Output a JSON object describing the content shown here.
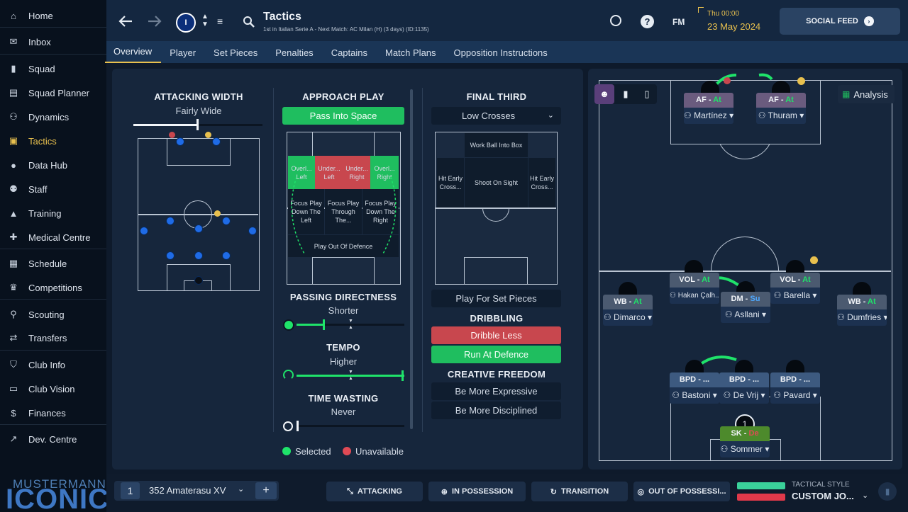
{
  "sidebar": {
    "items": [
      {
        "label": "Home",
        "icon": "home-icon",
        "glyph": "⌂"
      },
      {
        "label": "Inbox",
        "icon": "inbox-icon",
        "glyph": "✉"
      },
      {
        "label": "Squad",
        "icon": "shirt-icon",
        "glyph": "▮"
      },
      {
        "label": "Squad Planner",
        "icon": "clipboard-icon",
        "glyph": "▤"
      },
      {
        "label": "Dynamics",
        "icon": "people-icon",
        "glyph": "⚇"
      },
      {
        "label": "Tactics",
        "icon": "tactics-board-icon",
        "glyph": "▣"
      },
      {
        "label": "Data Hub",
        "icon": "globe-icon",
        "glyph": "●"
      },
      {
        "label": "Staff",
        "icon": "staff-icon",
        "glyph": "⚉"
      },
      {
        "label": "Training",
        "icon": "cone-icon",
        "glyph": "▲"
      },
      {
        "label": "Medical Centre",
        "icon": "medical-icon",
        "glyph": "✚"
      },
      {
        "label": "Schedule",
        "icon": "calendar-icon",
        "glyph": "▦"
      },
      {
        "label": "Competitions",
        "icon": "trophy-icon",
        "glyph": "♛"
      },
      {
        "label": "Scouting",
        "icon": "magnifier-icon",
        "glyph": "⚲"
      },
      {
        "label": "Transfers",
        "icon": "transfer-icon",
        "glyph": "⇄"
      },
      {
        "label": "Club Info",
        "icon": "shield-icon",
        "glyph": "⛉"
      },
      {
        "label": "Club Vision",
        "icon": "briefcase-icon",
        "glyph": "▭"
      },
      {
        "label": "Finances",
        "icon": "money-icon",
        "glyph": "$"
      },
      {
        "label": "Dev. Centre",
        "icon": "trend-icon",
        "glyph": "↗"
      }
    ],
    "brand_top": "MUSTERMANN",
    "brand_bottom": "ICONIC"
  },
  "header": {
    "title": "Tactics",
    "subtitle": "1st in Italian Serie A - Next Match: AC Milan (H) (3 days) (ID:1135)",
    "fm": "FM",
    "day": "Thu 00:00",
    "date": "23 May 2024",
    "social": "SOCIAL FEED"
  },
  "tabs": [
    "Overview",
    "Player",
    "Set Pieces",
    "Penalties",
    "Captains",
    "Match Plans",
    "Opposition Instructions"
  ],
  "attacking_width": {
    "title": "ATTACKING WIDTH",
    "value": "Fairly Wide",
    "level": 0.5
  },
  "approach": {
    "title": "APPROACH PLAY",
    "selected": "Pass Into Space",
    "zones": {
      "ol": "Overl... Left",
      "ul": "Under... Left",
      "ur": "Under... Right",
      "or": "Overl... Right",
      "fl": "Focus Play Down The Left",
      "fc": "Focus Play Through The...",
      "fr": "Focus Play Down The Right",
      "out": "Play Out Of Defence"
    }
  },
  "passing": {
    "title": "PASSING DIRECTNESS",
    "value": "Shorter",
    "level": 0.25
  },
  "tempo": {
    "title": "TEMPO",
    "value": "Higher",
    "level": 1.0
  },
  "timewasting": {
    "title": "TIME WASTING",
    "value": "Never",
    "level": 0.0
  },
  "final_third": {
    "title": "FINAL THIRD",
    "dropdown": "Low Crosses",
    "zones": {
      "work": "Work Ball Into Box",
      "hl": "Hit Early Cross...",
      "shoot": "Shoot On Sight",
      "hr": "Hit Early Cross..."
    },
    "setpieces": "Play For Set Pieces"
  },
  "dribbling": {
    "title": "DRIBBLING",
    "less": "Dribble Less",
    "run": "Run At Defence"
  },
  "creative": {
    "title": "CREATIVE FREEDOM",
    "expr": "Be More Expressive",
    "disc": "Be More Disciplined"
  },
  "legend": {
    "selected": "Selected",
    "unavailable": "Unavailable"
  },
  "analysis": "Analysis",
  "players": [
    {
      "role": "AF",
      "duty": "At",
      "name": "Martínez"
    },
    {
      "role": "AF",
      "duty": "At",
      "name": "Thuram"
    },
    {
      "role": "VOL",
      "duty": "At",
      "name": "Hakan Çalh..."
    },
    {
      "role": "VOL",
      "duty": "At",
      "name": "Barella"
    },
    {
      "role": "DM",
      "duty": "Su",
      "name": "Asllani"
    },
    {
      "role": "WB",
      "duty": "At",
      "name": "Dimarco"
    },
    {
      "role": "WB",
      "duty": "At",
      "name": "Dumfries"
    },
    {
      "role": "BPD",
      "duty": "...",
      "name": "Bastoni"
    },
    {
      "role": "BPD",
      "duty": "...",
      "name": "De Vrij"
    },
    {
      "role": "BPD",
      "duty": "...",
      "name": "Pavard"
    },
    {
      "role": "SK",
      "duty": "De",
      "name": "Sommer",
      "number": "1"
    }
  ],
  "bottom": {
    "slot": "1",
    "tactic": "352 Amaterasu XV",
    "attacking": "ATTACKING",
    "possession": "IN POSSESSION",
    "transition": "TRANSITION",
    "oop": "OUT OF POSSESSI...",
    "style_label": "TACTICAL STYLE",
    "style_value": "CUSTOM JO..."
  },
  "colors": {
    "accent": "#e8c04e",
    "green": "#1fbe5f",
    "red": "#c8474e",
    "blue": "#1f6be6"
  }
}
